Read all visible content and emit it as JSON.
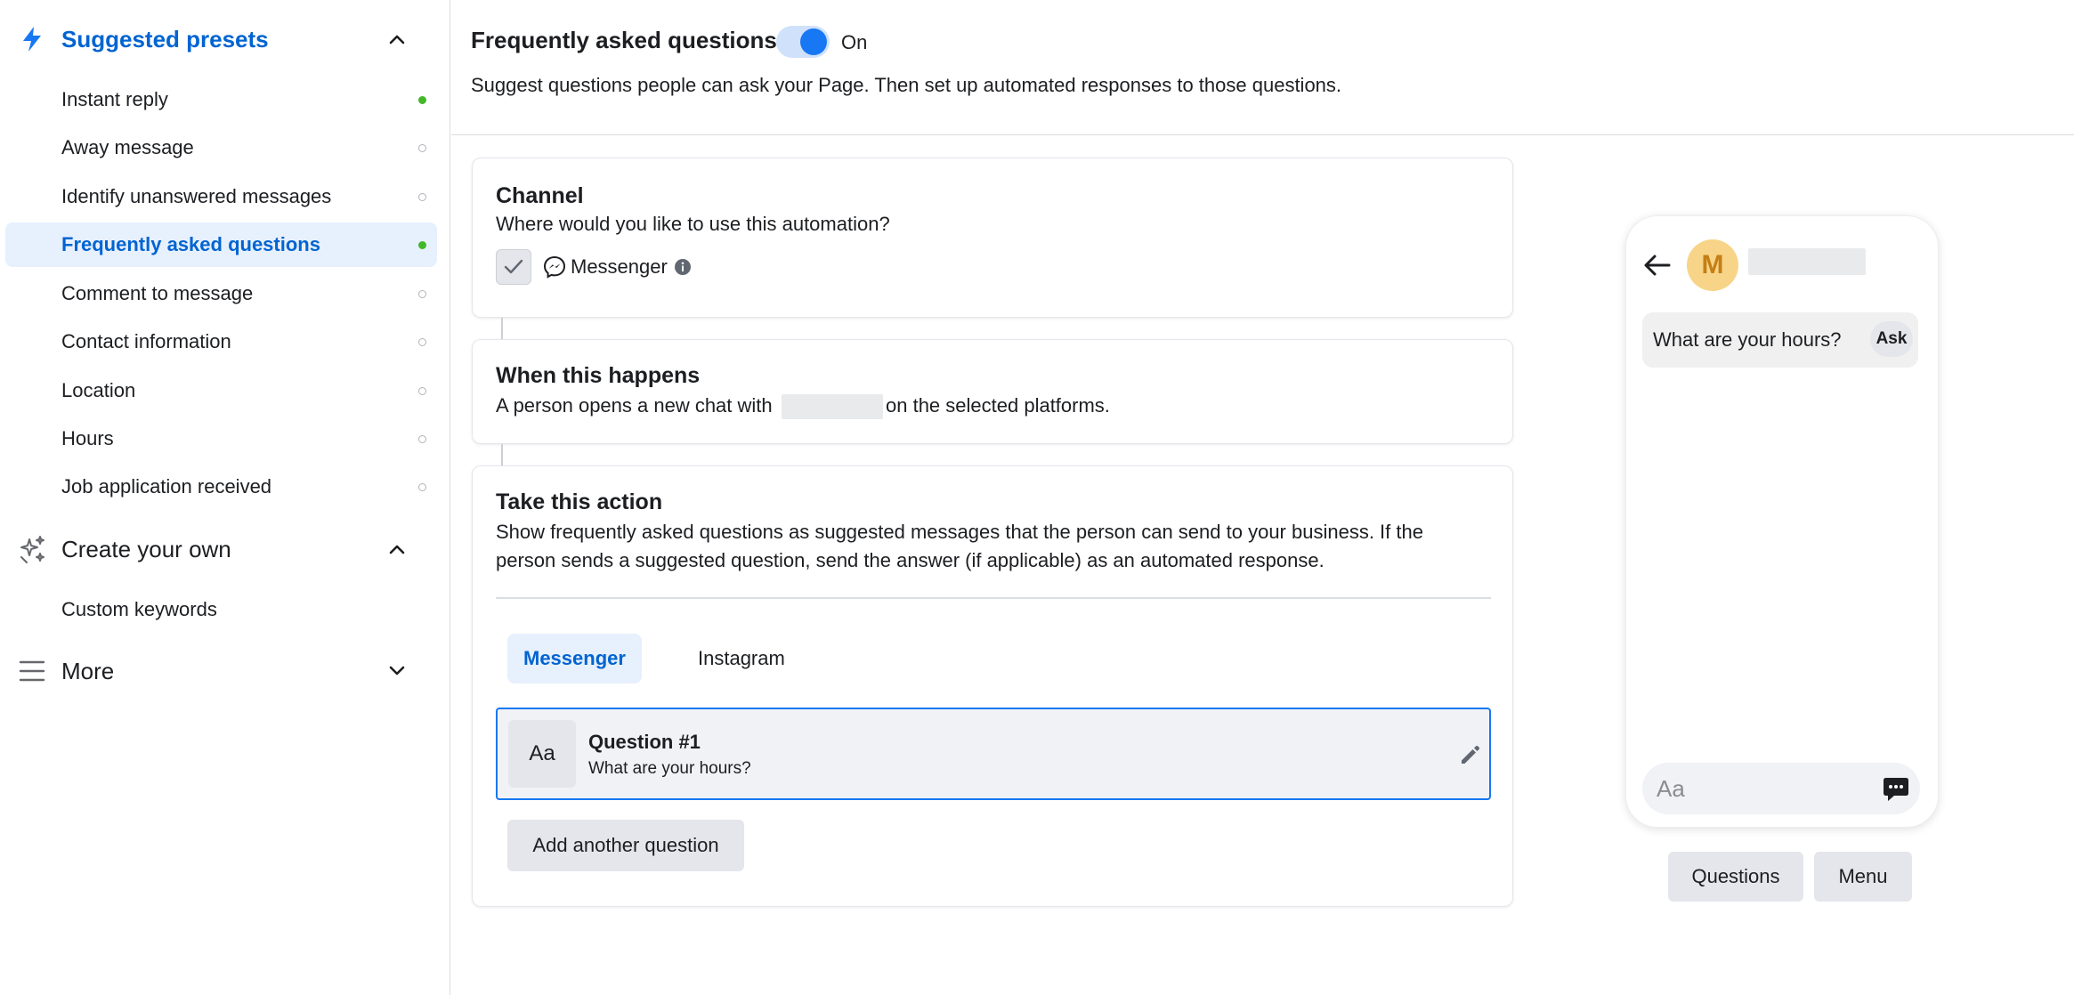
{
  "sidebar": {
    "suggested_presets": {
      "label": "Suggested presets",
      "icon": "lightning-icon",
      "expanded": true,
      "items": [
        {
          "label": "Instant reply",
          "status": "on"
        },
        {
          "label": "Away message",
          "status": "off"
        },
        {
          "label": "Identify unanswered messages",
          "status": "off"
        },
        {
          "label": "Frequently asked questions",
          "status": "on",
          "active": true
        },
        {
          "label": "Comment to message",
          "status": "off"
        },
        {
          "label": "Contact information",
          "status": "off"
        },
        {
          "label": "Location",
          "status": "off"
        },
        {
          "label": "Hours",
          "status": "off"
        },
        {
          "label": "Job application received",
          "status": "off"
        }
      ]
    },
    "create_your_own": {
      "label": "Create your own",
      "icon": "sparkles-icon",
      "expanded": true,
      "items": [
        {
          "label": "Custom keywords"
        }
      ]
    },
    "more": {
      "label": "More",
      "icon": "menu-icon",
      "expanded": false
    }
  },
  "header": {
    "title": "Frequently asked questions",
    "toggle_state": "On",
    "description": "Suggest questions people can ask your Page. Then set up automated responses to those questions."
  },
  "channel_card": {
    "title": "Channel",
    "prompt": "Where would you like to use this automation?",
    "option_label": "Messenger",
    "checked": true
  },
  "trigger_card": {
    "title": "When this happens",
    "text_before": "A person opens a new chat with",
    "text_after": "on the selected platforms."
  },
  "action_card": {
    "title": "Take this action",
    "description": "Show frequently asked questions as suggested messages that the person can send to your business. If the person sends a suggested question, send the answer (if applicable) as an automated response.",
    "tabs": [
      {
        "label": "Messenger",
        "active": true
      },
      {
        "label": "Instagram",
        "active": false
      }
    ],
    "question": {
      "icon_text": "Aa",
      "title": "Question #1",
      "text": "What are your hours?"
    },
    "add_button": "Add another question"
  },
  "preview": {
    "avatar_letter": "M",
    "suggested_question": "What are your hours?",
    "ask_label": "Ask",
    "composer_placeholder": "Aa",
    "buttons": [
      "Questions",
      "Menu"
    ]
  },
  "colors": {
    "accent": "#0064d1",
    "toggle_on": "#1877f2",
    "status_on": "#42b72a",
    "active_bg": "#e7f0fd",
    "avatar_bg": "#f7d488"
  }
}
